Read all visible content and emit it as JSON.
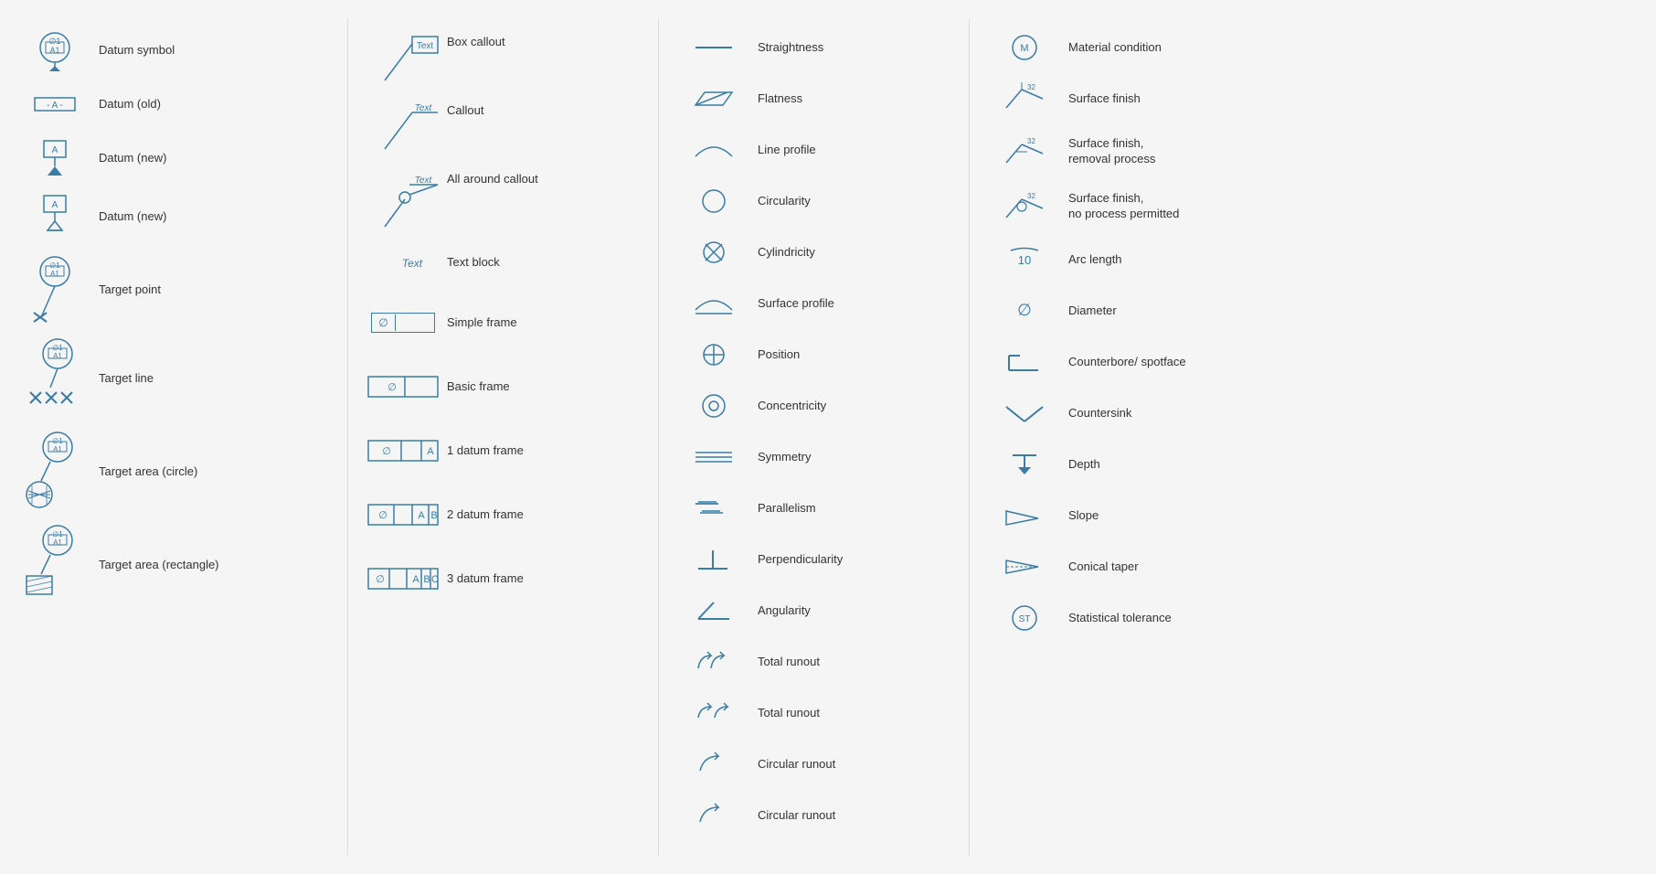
{
  "col1": {
    "items": [
      {
        "id": "datum-symbol",
        "label": "Datum symbol"
      },
      {
        "id": "datum-old",
        "label": "Datum (old)"
      },
      {
        "id": "datum-new-1",
        "label": "Datum (new)"
      },
      {
        "id": "datum-new-2",
        "label": "Datum (new)"
      },
      {
        "id": "target-point",
        "label": "Target point"
      },
      {
        "id": "target-line",
        "label": "Target line"
      },
      {
        "id": "target-area-circle",
        "label": "Target area (circle)"
      },
      {
        "id": "target-area-rect",
        "label": "Target area (rectangle)"
      }
    ]
  },
  "col2": {
    "items": [
      {
        "id": "box-callout",
        "label": "Box callout"
      },
      {
        "id": "callout",
        "label": "Callout"
      },
      {
        "id": "all-around-callout",
        "label": "All around callout"
      },
      {
        "id": "text-block",
        "label": "Text block"
      },
      {
        "id": "simple-frame",
        "label": "Simple frame"
      },
      {
        "id": "basic-frame",
        "label": "Basic frame"
      },
      {
        "id": "1-datum-frame",
        "label": "1 datum frame"
      },
      {
        "id": "2-datum-frame",
        "label": "2 datum frame"
      },
      {
        "id": "3-datum-frame",
        "label": "3 datum frame"
      }
    ]
  },
  "col3": {
    "items": [
      {
        "id": "straightness",
        "label": "Straightness"
      },
      {
        "id": "flatness",
        "label": "Flatness"
      },
      {
        "id": "line-profile",
        "label": "Line profile"
      },
      {
        "id": "circularity",
        "label": "Circularity"
      },
      {
        "id": "cylindricity",
        "label": "Cylindricity"
      },
      {
        "id": "surface-profile",
        "label": "Surface profile"
      },
      {
        "id": "position",
        "label": "Position"
      },
      {
        "id": "concentricity",
        "label": "Concentricity"
      },
      {
        "id": "symmetry",
        "label": "Symmetry"
      },
      {
        "id": "parallelism",
        "label": "Parallelism"
      },
      {
        "id": "perpendicularity",
        "label": "Perpendicularity"
      },
      {
        "id": "angularity",
        "label": "Angularity"
      },
      {
        "id": "total-runout-1",
        "label": "Total runout"
      },
      {
        "id": "total-runout-2",
        "label": "Total runout"
      },
      {
        "id": "circular-runout-1",
        "label": "Circular runout"
      },
      {
        "id": "circular-runout-2",
        "label": "Circular runout"
      }
    ]
  },
  "col4": {
    "items": [
      {
        "id": "material-condition",
        "label": "Material condition"
      },
      {
        "id": "surface-finish",
        "label": "Surface finish"
      },
      {
        "id": "surface-finish-removal",
        "label": "Surface finish,\nremoval process"
      },
      {
        "id": "surface-finish-no-process",
        "label": "Surface finish,\nno process permitted"
      },
      {
        "id": "arc-length",
        "label": "Arc length"
      },
      {
        "id": "diameter",
        "label": "Diameter"
      },
      {
        "id": "counterbore",
        "label": "Counterbore/ spotface"
      },
      {
        "id": "countersink",
        "label": "Countersink"
      },
      {
        "id": "depth",
        "label": "Depth"
      },
      {
        "id": "slope",
        "label": "Slope"
      },
      {
        "id": "conical-taper",
        "label": "Conical taper"
      },
      {
        "id": "statistical-tolerance",
        "label": "Statistical tolerance"
      }
    ]
  }
}
